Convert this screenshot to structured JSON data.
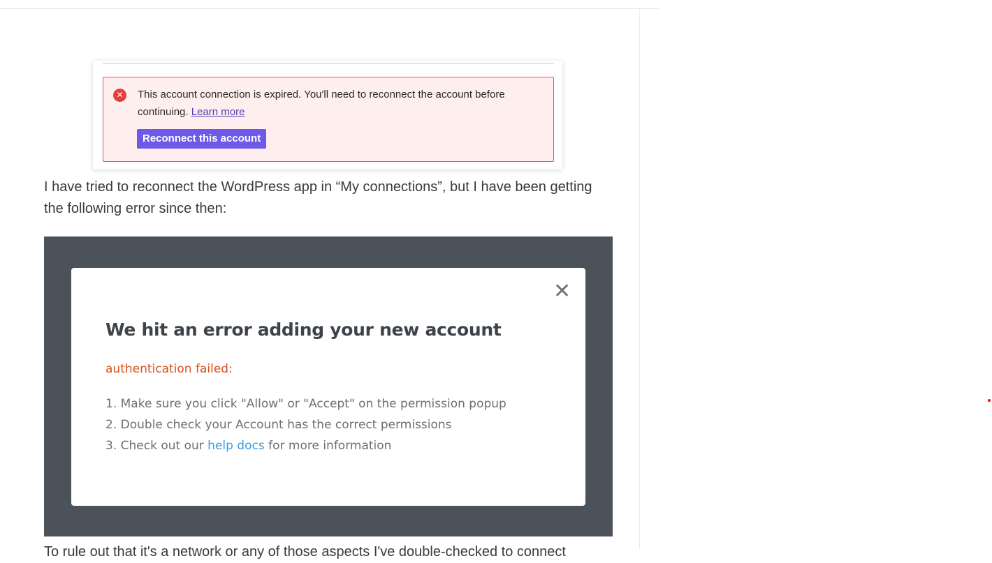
{
  "post": {
    "screenshot1": {
      "alert_message": "This account connection is expired. You'll need to reconnect the account before continuing.",
      "learn_more_label": "Learn more",
      "reconnect_button_label": "Reconnect this account",
      "icon": "error-x-icon"
    },
    "paragraph": "I have tried to reconnect the WordPress app in “My connections”, but I have been getting the following error since then:",
    "screenshot2": {
      "close_icon": "close-icon",
      "title": "We hit an error adding your new account",
      "error_label": "authentication failed:",
      "steps": [
        {
          "number": "1.",
          "text": "Make sure you click \"Allow\" or \"Accept\" on the permission popup"
        },
        {
          "number": "2.",
          "text": "Double check your Account has the correct permissions"
        },
        {
          "number": "3.",
          "prefix": "Check out our",
          "link": "help docs",
          "suffix": "for more information"
        }
      ]
    },
    "cut_off_paragraph": "To rule out that it's a network or any of those aspects I've double-checked to connect"
  },
  "colors": {
    "accent_purple": "#6e5ae8",
    "alert_bg": "#feeeed",
    "alert_border": "#e05a5a",
    "error_orange": "#d9501f",
    "link_blue": "#3b9be0",
    "modal_overlay": "#4b525a"
  }
}
